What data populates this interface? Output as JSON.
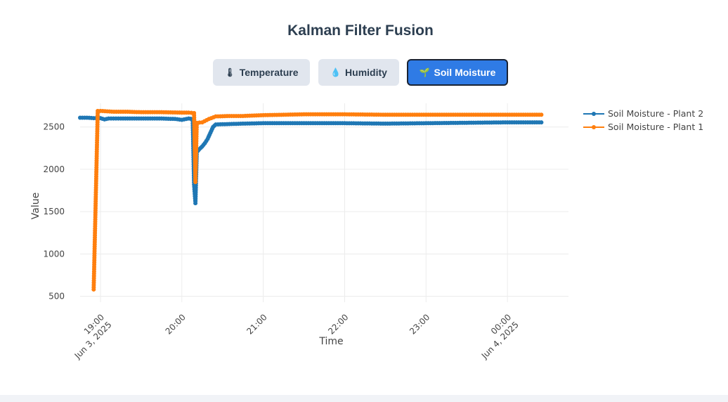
{
  "title": "Kalman Filter Fusion",
  "tabs": [
    {
      "label": "Temperature",
      "icon": "thermometer-icon",
      "icon_glyph": "🌡",
      "active": false
    },
    {
      "label": "Humidity",
      "icon": "droplet-icon",
      "icon_glyph": "💧",
      "active": false
    },
    {
      "label": "Soil Moisture",
      "icon": "seedling-icon",
      "icon_glyph": "🌱",
      "active": true
    }
  ],
  "colors": {
    "plant2": "#1f77b4",
    "plant1": "#ff7f0e",
    "active_tab": "#2f7be5"
  },
  "chart_data": {
    "type": "line",
    "xlabel": "Time",
    "ylabel": "Value",
    "ylim": [
      430,
      2780
    ],
    "xlim": [
      "18:45",
      "00:45"
    ],
    "x_ticks": [
      {
        "label": "19:00",
        "sub": "Jun 3, 2025",
        "t": 0
      },
      {
        "label": "20:00",
        "sub": "",
        "t": 60
      },
      {
        "label": "21:00",
        "sub": "",
        "t": 120
      },
      {
        "label": "22:00",
        "sub": "",
        "t": 180
      },
      {
        "label": "23:00",
        "sub": "",
        "t": 240
      },
      {
        "label": "00:00",
        "sub": "Jun 4, 2025",
        "t": 300
      }
    ],
    "y_ticks": [
      500,
      1000,
      1500,
      2000,
      2500
    ],
    "grid": true,
    "legend_position": "top-right",
    "series": [
      {
        "name": "Soil Moisture - Plant 2",
        "color": "#1f77b4",
        "points": [
          [
            "18:45",
            2610
          ],
          [
            "18:50",
            2610
          ],
          [
            "18:55",
            2605
          ],
          [
            "19:00",
            2605
          ],
          [
            "19:03",
            2590
          ],
          [
            "19:06",
            2600
          ],
          [
            "19:15",
            2600
          ],
          [
            "19:30",
            2600
          ],
          [
            "19:45",
            2600
          ],
          [
            "19:55",
            2595
          ],
          [
            "20:00",
            2585
          ],
          [
            "20:05",
            2600
          ],
          [
            "20:08",
            2595
          ],
          [
            "20:09",
            1820
          ],
          [
            "20:10",
            1600
          ],
          [
            "20:11",
            2200
          ],
          [
            "20:13",
            2240
          ],
          [
            "20:15",
            2270
          ],
          [
            "20:17",
            2310
          ],
          [
            "20:19",
            2360
          ],
          [
            "20:21",
            2430
          ],
          [
            "20:23",
            2500
          ],
          [
            "20:25",
            2530
          ],
          [
            "20:35",
            2535
          ],
          [
            "20:45",
            2540
          ],
          [
            "21:00",
            2545
          ],
          [
            "21:30",
            2545
          ],
          [
            "22:00",
            2545
          ],
          [
            "22:30",
            2540
          ],
          [
            "23:00",
            2545
          ],
          [
            "23:30",
            2550
          ],
          [
            "00:00",
            2555
          ],
          [
            "00:25",
            2555
          ]
        ]
      },
      {
        "name": "Soil Moisture - Plant 1",
        "color": "#ff7f0e",
        "points": [
          [
            "18:55",
            580
          ],
          [
            "18:58",
            2690
          ],
          [
            "19:00",
            2690
          ],
          [
            "19:05",
            2685
          ],
          [
            "19:10",
            2680
          ],
          [
            "19:20",
            2680
          ],
          [
            "19:30",
            2675
          ],
          [
            "19:45",
            2675
          ],
          [
            "20:00",
            2670
          ],
          [
            "20:05",
            2670
          ],
          [
            "20:09",
            2665
          ],
          [
            "20:10",
            1850
          ],
          [
            "20:11",
            2550
          ],
          [
            "20:15",
            2555
          ],
          [
            "20:20",
            2595
          ],
          [
            "20:25",
            2625
          ],
          [
            "20:35",
            2630
          ],
          [
            "20:45",
            2630
          ],
          [
            "21:00",
            2640
          ],
          [
            "21:30",
            2650
          ],
          [
            "22:00",
            2650
          ],
          [
            "22:30",
            2645
          ],
          [
            "23:00",
            2645
          ],
          [
            "23:30",
            2645
          ],
          [
            "00:00",
            2645
          ],
          [
            "00:25",
            2645
          ]
        ]
      }
    ]
  }
}
